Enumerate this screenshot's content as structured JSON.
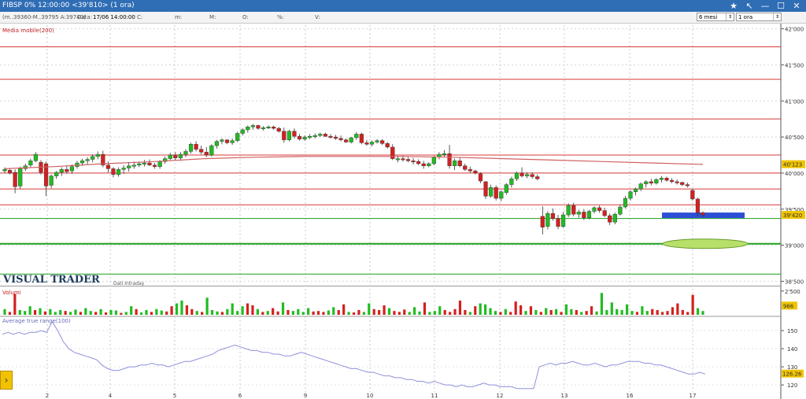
{
  "titlebar": {
    "title": "FIBSP 0% 12:00:00  <39'810> (1 ora)"
  },
  "toolbar": {
    "quote": "(m..39360-M..39795 A:39740)",
    "data_label": "Data:",
    "data_value": "17/06 14:00:00",
    "c_label": "C:",
    "m_label": "m:",
    "M_label": "M:",
    "O_label": "O:",
    "pct_label": "%:",
    "V_label": "V:",
    "period": "6 mesi",
    "interval": "1 ora"
  },
  "icons": [
    "star-icon",
    "cursor-icon",
    "minimize-icon",
    "maximize-icon",
    "close-icon"
  ],
  "colors": {
    "up": "#22bb22",
    "down": "#d42020",
    "sma": "#d06060",
    "atr": "#9090dd",
    "h_red": "#d83838",
    "h_green": "#1fa01f",
    "marker_blue": "#2d4fd6",
    "marker_green": "#b7e06a"
  },
  "chart_data": [
    {
      "type": "candlestick",
      "indicator_label": "Media mobile(200)",
      "watermark": "VISUAL TRADER",
      "sub_label": "Dati Intraday",
      "x_tick_labels": [
        "2",
        "4",
        "5",
        "6",
        "9",
        "10",
        "11",
        "12",
        "13",
        "16",
        "17"
      ],
      "y_tick_labels": [
        "42'000",
        "41'500",
        "41'000",
        "40'500",
        "40'000",
        "39'500",
        "39'000",
        "38'500"
      ],
      "y_ticks": [
        42000,
        41500,
        41000,
        40500,
        40000,
        39500,
        39000,
        38500
      ],
      "ylim": [
        38450,
        42050
      ],
      "price_tags": [
        "40'123",
        "39'420"
      ],
      "price_tag_values": [
        40123,
        39420
      ],
      "horizontal_red_levels": [
        41750,
        41300,
        40750,
        40250,
        40000,
        39780,
        39560
      ],
      "horizontal_green_levels": [
        39370,
        39020,
        38600
      ],
      "sma_values": [
        40060,
        40090,
        40130,
        40160,
        40200,
        40220,
        40230,
        40230,
        40230,
        40220,
        40200,
        40180,
        40160,
        40140,
        40120
      ],
      "ohlc": [
        [
          40030,
          40080,
          40000,
          40050
        ],
        [
          40040,
          40060,
          39980,
          40000
        ],
        [
          40010,
          40050,
          39720,
          39810
        ],
        [
          39820,
          40090,
          39780,
          40060
        ],
        [
          40060,
          40130,
          40030,
          40100
        ],
        [
          40110,
          40200,
          40080,
          40170
        ],
        [
          40170,
          40290,
          40150,
          40260
        ],
        [
          40150,
          40180,
          39980,
          40010
        ],
        [
          40130,
          40160,
          39680,
          39820
        ],
        [
          39830,
          39980,
          39790,
          39960
        ],
        [
          39960,
          40030,
          39920,
          40010
        ],
        [
          40010,
          40080,
          39960,
          40050
        ],
        [
          40050,
          40100,
          39990,
          40020
        ],
        [
          40030,
          40120,
          39990,
          40090
        ],
        [
          40090,
          40170,
          40060,
          40140
        ],
        [
          40140,
          40200,
          40100,
          40170
        ],
        [
          40170,
          40220,
          40120,
          40190
        ],
        [
          40190,
          40260,
          40150,
          40230
        ],
        [
          40230,
          40300,
          40190,
          40260
        ],
        [
          40260,
          40310,
          40080,
          40110
        ],
        [
          40110,
          40160,
          40010,
          40060
        ],
        [
          40060,
          40080,
          39940,
          39980
        ],
        [
          39980,
          40080,
          39950,
          40050
        ],
        [
          40050,
          40110,
          39990,
          40070
        ],
        [
          40070,
          40150,
          40020,
          40100
        ],
        [
          40100,
          40160,
          40060,
          40110
        ],
        [
          40110,
          40160,
          40080,
          40130
        ],
        [
          40130,
          40180,
          40090,
          40140
        ],
        [
          40140,
          40190,
          40100,
          40110
        ],
        [
          40110,
          40140,
          40060,
          40090
        ],
        [
          40090,
          40180,
          40060,
          40160
        ],
        [
          40160,
          40230,
          40130,
          40200
        ],
        [
          40200,
          40280,
          40180,
          40250
        ],
        [
          40250,
          40290,
          40180,
          40210
        ],
        [
          40210,
          40290,
          40170,
          40260
        ],
        [
          40260,
          40330,
          40220,
          40300
        ],
        [
          40300,
          40420,
          40270,
          40400
        ],
        [
          40400,
          40440,
          40300,
          40330
        ],
        [
          40330,
          40380,
          40260,
          40290
        ],
        [
          40290,
          40360,
          40220,
          40250
        ],
        [
          40250,
          40400,
          40230,
          40380
        ],
        [
          40380,
          40460,
          40340,
          40440
        ],
        [
          40440,
          40480,
          40400,
          40460
        ],
        [
          40460,
          40470,
          40400,
          40420
        ],
        [
          40420,
          40480,
          40390,
          40450
        ],
        [
          40450,
          40570,
          40430,
          40550
        ],
        [
          40550,
          40620,
          40520,
          40600
        ],
        [
          40600,
          40660,
          40560,
          40640
        ],
        [
          40640,
          40680,
          40600,
          40660
        ],
        [
          40660,
          40670,
          40600,
          40620
        ],
        [
          40620,
          40650,
          40590,
          40630
        ],
        [
          40630,
          40660,
          40610,
          40640
        ],
        [
          40640,
          40660,
          40600,
          40620
        ],
        [
          40620,
          40640,
          40560,
          40580
        ],
        [
          40580,
          40630,
          40420,
          40460
        ],
        [
          40460,
          40600,
          40440,
          40580
        ],
        [
          40580,
          40620,
          40480,
          40510
        ],
        [
          40510,
          40540,
          40450,
          40470
        ],
        [
          40470,
          40520,
          40450,
          40500
        ],
        [
          40500,
          40540,
          40470,
          40510
        ],
        [
          40510,
          40550,
          40480,
          40520
        ],
        [
          40520,
          40560,
          40500,
          40540
        ],
        [
          40540,
          40560,
          40500,
          40510
        ],
        [
          40510,
          40540,
          40480,
          40500
        ],
        [
          40500,
          40530,
          40460,
          40480
        ],
        [
          40480,
          40520,
          40440,
          40460
        ],
        [
          40460,
          40480,
          40420,
          40430
        ],
        [
          40430,
          40500,
          40410,
          40490
        ],
        [
          40490,
          40570,
          40460,
          40540
        ],
        [
          40540,
          40560,
          40400,
          40420
        ],
        [
          40420,
          40460,
          40380,
          40400
        ],
        [
          40400,
          40450,
          40370,
          40430
        ],
        [
          40430,
          40470,
          40410,
          40450
        ],
        [
          40450,
          40470,
          40390,
          40410
        ],
        [
          40410,
          40430,
          40340,
          40360
        ],
        [
          40360,
          40400,
          40180,
          40200
        ],
        [
          40200,
          40240,
          40150,
          40200
        ],
        [
          40200,
          40240,
          40160,
          40190
        ],
        [
          40190,
          40220,
          40150,
          40170
        ],
        [
          40170,
          40210,
          40120,
          40160
        ],
        [
          40160,
          40190,
          40110,
          40130
        ],
        [
          40130,
          40170,
          40060,
          40100
        ],
        [
          40100,
          40150,
          40080,
          40130
        ],
        [
          40130,
          40240,
          40110,
          40220
        ],
        [
          40220,
          40290,
          40190,
          40260
        ],
        [
          40260,
          40320,
          40220,
          40270
        ],
        [
          40270,
          40390,
          40060,
          40100
        ],
        [
          40100,
          40200,
          40040,
          40170
        ],
        [
          40170,
          40210,
          40080,
          40100
        ],
        [
          40100,
          40130,
          40030,
          40050
        ],
        [
          40050,
          40090,
          40000,
          40030
        ],
        [
          40030,
          40050,
          39980,
          40000
        ],
        [
          39990,
          40010,
          39860,
          39890
        ],
        [
          39880,
          39890,
          39640,
          39680
        ],
        [
          39680,
          39840,
          39660,
          39800
        ],
        [
          39800,
          39830,
          39620,
          39650
        ],
        [
          39650,
          39760,
          39610,
          39740
        ],
        [
          39730,
          39860,
          39700,
          39840
        ],
        [
          39840,
          39950,
          39800,
          39920
        ],
        [
          39920,
          40020,
          39890,
          40000
        ],
        [
          40000,
          40080,
          39940,
          39960
        ],
        [
          39960,
          40010,
          39930,
          39980
        ],
        [
          39980,
          40010,
          39920,
          39950
        ],
        [
          39950,
          39980,
          39900,
          39920
        ],
        [
          39400,
          39540,
          39150,
          39250
        ],
        [
          39260,
          39470,
          39220,
          39440
        ],
        [
          39440,
          39510,
          39340,
          39370
        ],
        [
          39370,
          39420,
          39220,
          39260
        ],
        [
          39260,
          39460,
          39240,
          39420
        ],
        [
          39420,
          39580,
          39390,
          39550
        ],
        [
          39550,
          39590,
          39400,
          39430
        ],
        [
          39430,
          39490,
          39380,
          39460
        ],
        [
          39460,
          39500,
          39350,
          39380
        ],
        [
          39380,
          39490,
          39360,
          39470
        ],
        [
          39470,
          39540,
          39440,
          39520
        ],
        [
          39520,
          39550,
          39450,
          39480
        ],
        [
          39480,
          39520,
          39390,
          39410
        ],
        [
          39410,
          39440,
          39280,
          39320
        ],
        [
          39320,
          39450,
          39290,
          39430
        ],
        [
          39430,
          39560,
          39410,
          39530
        ],
        [
          39530,
          39680,
          39510,
          39650
        ],
        [
          39650,
          39760,
          39620,
          39740
        ],
        [
          39740,
          39800,
          39690,
          39780
        ],
        [
          39780,
          39870,
          39750,
          39850
        ],
        [
          39850,
          39900,
          39800,
          39880
        ],
        [
          39880,
          39920,
          39830,
          39860
        ],
        [
          39860,
          39930,
          39840,
          39910
        ],
        [
          39910,
          39960,
          39870,
          39930
        ],
        [
          39930,
          39950,
          39880,
          39900
        ],
        [
          39900,
          39930,
          39860,
          39880
        ],
        [
          39880,
          39910,
          39840,
          39870
        ],
        [
          39870,
          39880,
          39820,
          39840
        ],
        [
          39840,
          39870,
          39800,
          39830
        ],
        [
          39760,
          39780,
          39620,
          39640
        ],
        [
          39640,
          39660,
          39400,
          39450
        ],
        [
          39450,
          39470,
          39390,
          39420
        ]
      ]
    },
    {
      "type": "bar",
      "label": "Volumi",
      "y_tick_labels": [
        "2'500"
      ],
      "value_tag": "966",
      "value_tag_value": 966,
      "ylim": [
        0,
        2900
      ],
      "values": [
        600,
        300,
        2200,
        500,
        400,
        900,
        500,
        700,
        350,
        600,
        300,
        500,
        400,
        300,
        550,
        300,
        700,
        400,
        300,
        600,
        250,
        500,
        450,
        200,
        300,
        900,
        600,
        250,
        500,
        300,
        600,
        450,
        350,
        900,
        1200,
        1500,
        1000,
        600,
        400,
        300,
        1800,
        500,
        350,
        300,
        600,
        1200,
        400,
        900,
        1200,
        1000,
        600,
        300,
        400,
        700,
        350,
        1300,
        500,
        400,
        600,
        300,
        700,
        350,
        400,
        300,
        450,
        800,
        500,
        1100,
        300,
        250,
        500,
        300,
        1200,
        600,
        500,
        1000,
        700,
        400,
        300,
        550,
        300,
        800,
        350,
        1300,
        300,
        400,
        900,
        500,
        300,
        600,
        1500,
        500,
        300,
        900,
        1200,
        1100,
        700,
        400,
        300,
        600,
        300,
        1400,
        1000,
        400,
        900,
        500,
        300,
        700,
        500,
        600,
        300,
        1100,
        600,
        500,
        300,
        400,
        900,
        350,
        2300,
        500,
        1300,
        600,
        500,
        1100,
        400,
        300,
        900,
        400,
        600,
        500,
        300,
        400,
        800,
        1200,
        500,
        300,
        2100,
        700,
        400
      ],
      "up": [
        1,
        0,
        0,
        1,
        1,
        1,
        0,
        1,
        0,
        1,
        1,
        1,
        0,
        1,
        1,
        0,
        1,
        1,
        0,
        1,
        0,
        1,
        1,
        0,
        1,
        1,
        0,
        1,
        1,
        0,
        1,
        1,
        0,
        0,
        1,
        1,
        0,
        0,
        1,
        0,
        1,
        1,
        1,
        0,
        1,
        1,
        1,
        1,
        0,
        0,
        1,
        0,
        1,
        0,
        0,
        1,
        0,
        1,
        1,
        1,
        1,
        0,
        0,
        0,
        1,
        1,
        0,
        0,
        1,
        0,
        0,
        1,
        1,
        0,
        0,
        0,
        1,
        0,
        0,
        0,
        1,
        1,
        1,
        0,
        1,
        1,
        1,
        0,
        0,
        0,
        0,
        0,
        1,
        0,
        1,
        1,
        1,
        1,
        0,
        1,
        0,
        0,
        0,
        1,
        0,
        1,
        0,
        1,
        0,
        1,
        0,
        1,
        1,
        0,
        1,
        0,
        0,
        1,
        1,
        1,
        1,
        1,
        1,
        1,
        1,
        0,
        1,
        1,
        0,
        0,
        0,
        0,
        0,
        0,
        0,
        0,
        0,
        1,
        1,
        0,
        0
      ]
    },
    {
      "type": "line",
      "label": "Average true range(100)",
      "y_tick_labels": [
        "150",
        "140",
        "130",
        "120"
      ],
      "y_ticks": [
        150,
        140,
        130,
        120
      ],
      "value_tag": "126.26",
      "value_tag_value": 126.26,
      "ylim": [
        117,
        157
      ],
      "values": [
        148,
        149,
        148,
        149,
        148,
        149,
        149,
        150,
        149,
        155,
        150,
        144,
        140,
        138,
        137,
        136,
        135,
        134,
        131,
        129,
        128,
        128,
        129,
        130,
        130,
        131,
        131,
        132,
        131,
        131,
        130,
        131,
        132,
        133,
        133,
        134,
        135,
        136,
        137,
        139,
        140,
        141,
        142,
        141,
        140,
        139,
        139,
        138,
        138,
        137,
        137,
        136,
        136,
        137,
        138,
        137,
        136,
        135,
        134,
        133,
        132,
        131,
        130,
        129,
        129,
        128,
        127,
        127,
        126,
        125,
        125,
        124,
        124,
        123,
        123,
        122,
        122,
        121,
        122,
        121,
        120,
        120,
        119,
        120,
        119,
        119,
        120,
        121,
        120,
        120,
        119,
        119,
        119,
        118,
        118,
        118,
        118,
        130,
        131,
        132,
        131,
        132,
        132,
        133,
        132,
        131,
        131,
        132,
        131,
        130,
        131,
        131,
        132,
        133,
        133,
        133,
        132,
        132,
        131,
        131,
        130,
        129,
        128,
        127,
        126,
        126,
        127,
        126
      ],
      "x_ticks_at": [
        15,
        35,
        55,
        75,
        95
      ]
    }
  ]
}
